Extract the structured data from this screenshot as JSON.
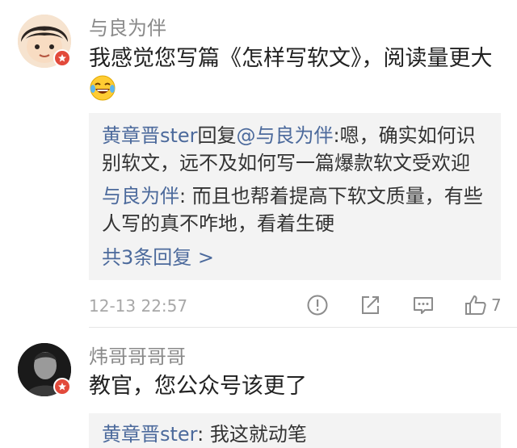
{
  "comments": [
    {
      "username": "与良为伴",
      "text_line1": "我感觉您写篇《怎样写软文》，阅读量更大",
      "emoji": "laughing-with-tears",
      "replies": {
        "r1_user": "黄章晋ster",
        "r1_verb": "回复",
        "r1_target": "@与良为伴",
        "r1_text_a": ":嗯，确实如何识",
        "r1_text_b": "别软文，远不及如何写一篇爆款软文受欢迎",
        "r2_user": "与良为伴",
        "r2_text_a": ": 而且也帮着提高下软文质量，有些",
        "r2_text_b": "人写的真不咋地，看着生硬",
        "more": "共3条回复 >"
      },
      "date": "12-13 22:57",
      "like_count": "7"
    },
    {
      "username": "炜哥哥哥哥",
      "text": "教官，您公众号该更了",
      "reply_user": "黄章晋ster",
      "reply_text": ": 我这就动笔"
    }
  ],
  "colors": {
    "link": "#4c6a9c",
    "badge": "#e24a3b",
    "reply_bg": "#f3f3f3"
  }
}
